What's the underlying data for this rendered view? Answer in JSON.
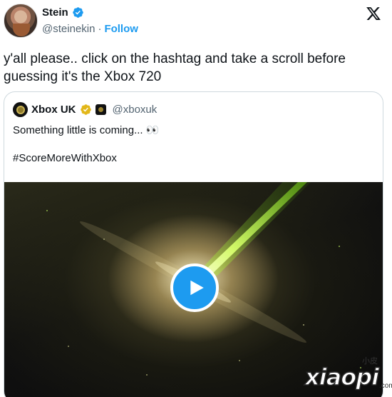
{
  "author": {
    "name": "Stein",
    "handle": "@steinekin",
    "follow_label": "Follow",
    "verified_color": "#1d9bf0"
  },
  "tweet": {
    "text": "y'all please.. click on the hashtag and take a scroll before guessing it's the Xbox 720"
  },
  "quoted": {
    "name": "Xbox UK",
    "handle": "@xboxuk",
    "badge_color": "#e2b719",
    "text": "Something little is coming... 👀",
    "hashtag": "#ScoreMoreWithXbox",
    "media": {
      "type": "video",
      "control": "play-icon",
      "accent": "#1d9bf0"
    }
  },
  "watermark": {
    "small": "小皮",
    "main": "xiaopi",
    "suffix": ".com"
  }
}
